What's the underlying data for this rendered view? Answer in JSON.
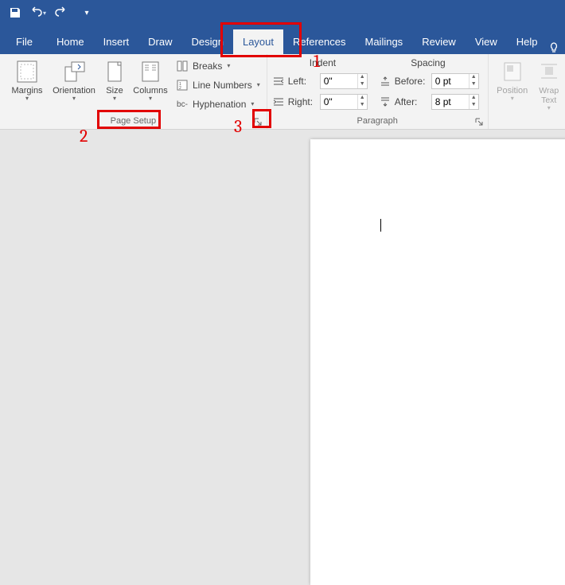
{
  "qat": {
    "save": "save-icon",
    "undo": "undo-icon",
    "redo": "redo-icon",
    "customize": "customize-icon"
  },
  "tabs": {
    "file": "File",
    "items": [
      "Home",
      "Insert",
      "Draw",
      "Design",
      "Layout",
      "References",
      "Mailings",
      "Review",
      "View",
      "Help"
    ],
    "active": "Layout"
  },
  "ribbon": {
    "pageSetup": {
      "margins": "Margins",
      "orientation": "Orientation",
      "size": "Size",
      "columns": "Columns",
      "breaks": "Breaks",
      "lineNumbers": "Line Numbers",
      "hyphenation": "Hyphenation",
      "groupLabel": "Page Setup"
    },
    "paragraph": {
      "indentHeader": "Indent",
      "spacingHeader": "Spacing",
      "leftLabel": "Left:",
      "rightLabel": "Right:",
      "beforeLabel": "Before:",
      "afterLabel": "After:",
      "leftValue": "0\"",
      "rightValue": "0\"",
      "beforeValue": "0 pt",
      "afterValue": "8 pt",
      "groupLabel": "Paragraph"
    },
    "arrange": {
      "position": "Position",
      "wrapText": "Wrap Text"
    }
  },
  "annotations": {
    "one": "1",
    "two": "2",
    "three": "3"
  }
}
